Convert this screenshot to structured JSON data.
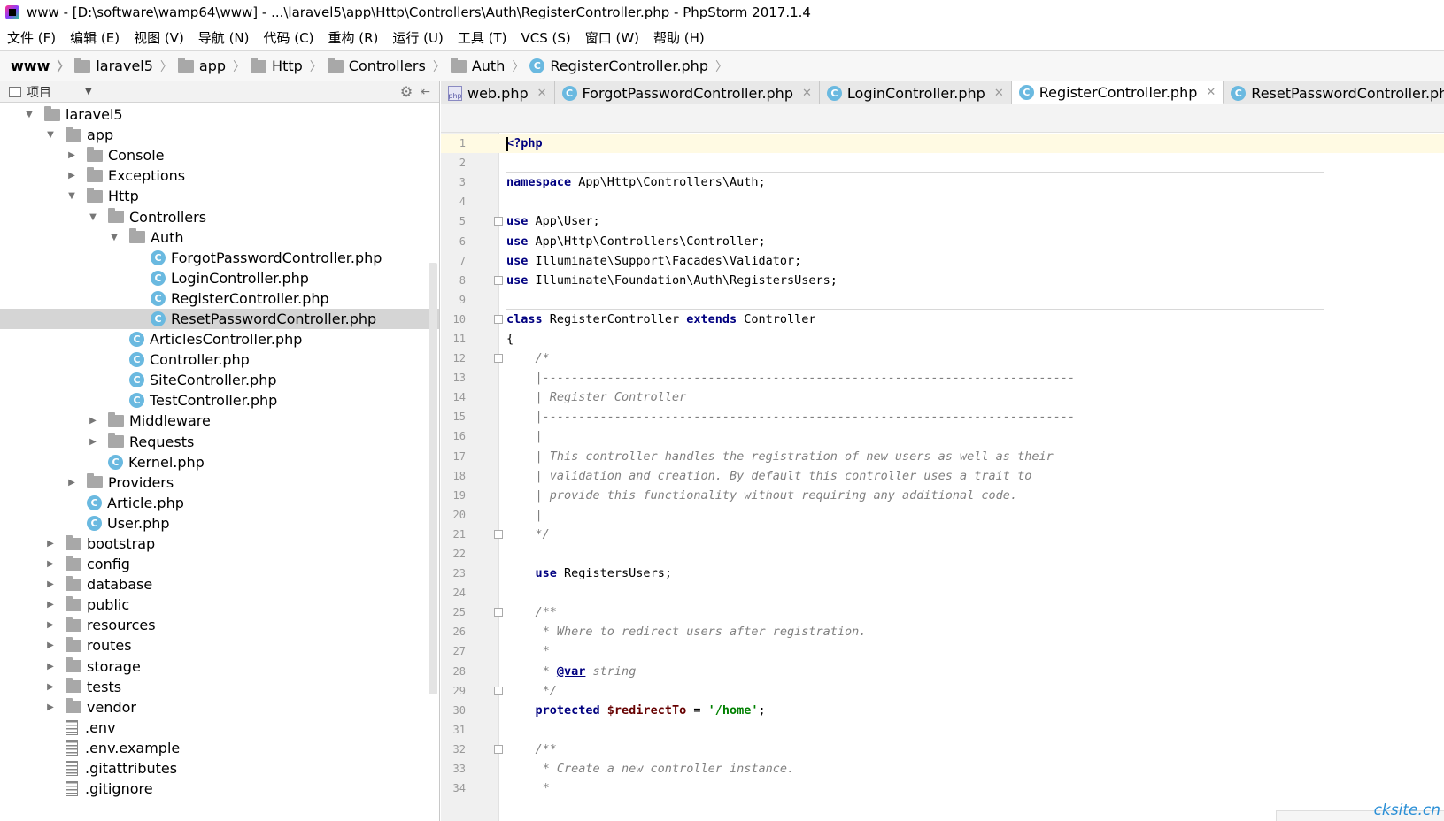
{
  "window": {
    "title": "www - [D:\\software\\wamp64\\www] - ...\\laravel5\\app\\Http\\Controllers\\Auth\\RegisterController.php - PhpStorm 2017.1.4"
  },
  "menu": [
    "文件 (F)",
    "编辑 (E)",
    "视图 (V)",
    "导航 (N)",
    "代码 (C)",
    "重构 (R)",
    "运行 (U)",
    "工具 (T)",
    "VCS (S)",
    "窗口 (W)",
    "帮助 (H)"
  ],
  "breadcrumb": [
    "www",
    "laravel5",
    "app",
    "Http",
    "Controllers",
    "Auth",
    "RegisterController.php"
  ],
  "project_panel": {
    "title": "项目",
    "tree": [
      {
        "label": "laravel5",
        "depth": 0,
        "type": "folder",
        "expanded": true
      },
      {
        "label": "app",
        "depth": 1,
        "type": "folder",
        "expanded": true
      },
      {
        "label": "Console",
        "depth": 2,
        "type": "folder",
        "expanded": false
      },
      {
        "label": "Exceptions",
        "depth": 2,
        "type": "folder",
        "expanded": false
      },
      {
        "label": "Http",
        "depth": 2,
        "type": "folder",
        "expanded": true
      },
      {
        "label": "Controllers",
        "depth": 3,
        "type": "folder",
        "expanded": true
      },
      {
        "label": "Auth",
        "depth": 4,
        "type": "folder",
        "expanded": true
      },
      {
        "label": "ForgotPasswordController.php",
        "depth": 5,
        "type": "class"
      },
      {
        "label": "LoginController.php",
        "depth": 5,
        "type": "class"
      },
      {
        "label": "RegisterController.php",
        "depth": 5,
        "type": "class"
      },
      {
        "label": "ResetPasswordController.php",
        "depth": 5,
        "type": "class",
        "selected": true
      },
      {
        "label": "ArticlesController.php",
        "depth": 4,
        "type": "class"
      },
      {
        "label": "Controller.php",
        "depth": 4,
        "type": "class"
      },
      {
        "label": "SiteController.php",
        "depth": 4,
        "type": "class"
      },
      {
        "label": "TestController.php",
        "depth": 4,
        "type": "class"
      },
      {
        "label": "Middleware",
        "depth": 3,
        "type": "folder",
        "expanded": false
      },
      {
        "label": "Requests",
        "depth": 3,
        "type": "folder",
        "expanded": false
      },
      {
        "label": "Kernel.php",
        "depth": 3,
        "type": "class"
      },
      {
        "label": "Providers",
        "depth": 2,
        "type": "folder",
        "expanded": false
      },
      {
        "label": "Article.php",
        "depth": 2,
        "type": "class"
      },
      {
        "label": "User.php",
        "depth": 2,
        "type": "class"
      },
      {
        "label": "bootstrap",
        "depth": 1,
        "type": "folder",
        "expanded": false
      },
      {
        "label": "config",
        "depth": 1,
        "type": "folder",
        "expanded": false
      },
      {
        "label": "database",
        "depth": 1,
        "type": "folder",
        "expanded": false
      },
      {
        "label": "public",
        "depth": 1,
        "type": "folder",
        "expanded": false
      },
      {
        "label": "resources",
        "depth": 1,
        "type": "folder",
        "expanded": false
      },
      {
        "label": "routes",
        "depth": 1,
        "type": "folder",
        "expanded": false
      },
      {
        "label": "storage",
        "depth": 1,
        "type": "folder",
        "expanded": false
      },
      {
        "label": "tests",
        "depth": 1,
        "type": "folder",
        "expanded": false
      },
      {
        "label": "vendor",
        "depth": 1,
        "type": "folder",
        "expanded": false
      },
      {
        "label": ".env",
        "depth": 1,
        "type": "file"
      },
      {
        "label": ".env.example",
        "depth": 1,
        "type": "file"
      },
      {
        "label": ".gitattributes",
        "depth": 1,
        "type": "file"
      },
      {
        "label": ".gitignore",
        "depth": 1,
        "type": "file"
      }
    ]
  },
  "tabs": [
    {
      "label": "web.php",
      "icon": "php",
      "active": false
    },
    {
      "label": "ForgotPasswordController.php",
      "icon": "class",
      "active": false
    },
    {
      "label": "LoginController.php",
      "icon": "class",
      "active": false
    },
    {
      "label": "RegisterController.php",
      "icon": "class",
      "active": true
    },
    {
      "label": "ResetPasswordController.php",
      "icon": "class",
      "active": false
    }
  ],
  "code": [
    {
      "n": "1",
      "current": true,
      "fold": false,
      "parts": [
        [
          "kw",
          "<?php"
        ]
      ]
    },
    {
      "n": "2",
      "fold": false,
      "parts": [],
      "hr": true
    },
    {
      "n": "3",
      "fold": false,
      "parts": [
        [
          "kw",
          "namespace "
        ],
        [
          "ns",
          "App\\Http\\Controllers\\Auth;"
        ]
      ]
    },
    {
      "n": "4",
      "fold": false,
      "parts": []
    },
    {
      "n": "5",
      "fold": true,
      "parts": [
        [
          "kw",
          "use "
        ],
        [
          "ns",
          "App\\User;"
        ]
      ]
    },
    {
      "n": "6",
      "fold": false,
      "parts": [
        [
          "kw",
          "use "
        ],
        [
          "ns",
          "App\\Http\\Controllers\\Controller;"
        ]
      ]
    },
    {
      "n": "7",
      "fold": false,
      "parts": [
        [
          "kw",
          "use "
        ],
        [
          "ns",
          "Illuminate\\Support\\Facades\\Validator;"
        ]
      ]
    },
    {
      "n": "8",
      "fold": true,
      "parts": [
        [
          "kw",
          "use "
        ],
        [
          "ns",
          "Illuminate\\Foundation\\Auth\\RegistersUsers;"
        ]
      ]
    },
    {
      "n": "9",
      "fold": false,
      "parts": [],
      "hr": true
    },
    {
      "n": "10",
      "fold": true,
      "parts": [
        [
          "kw",
          "class "
        ],
        [
          "ns",
          "RegisterController "
        ],
        [
          "kw",
          "extends "
        ],
        [
          "ns",
          "Controller"
        ]
      ]
    },
    {
      "n": "11",
      "fold": false,
      "parts": [
        [
          "ns",
          "{"
        ]
      ]
    },
    {
      "n": "12",
      "fold": true,
      "parts": [
        [
          "cm",
          "    /*"
        ]
      ]
    },
    {
      "n": "13",
      "fold": false,
      "parts": [
        [
          "cm",
          "    |--------------------------------------------------------------------------"
        ]
      ]
    },
    {
      "n": "14",
      "fold": false,
      "parts": [
        [
          "cm",
          "    | Register Controller"
        ]
      ]
    },
    {
      "n": "15",
      "fold": false,
      "parts": [
        [
          "cm",
          "    |--------------------------------------------------------------------------"
        ]
      ]
    },
    {
      "n": "16",
      "fold": false,
      "parts": [
        [
          "cm",
          "    |"
        ]
      ]
    },
    {
      "n": "17",
      "fold": false,
      "parts": [
        [
          "cm",
          "    | This controller handles the registration of new users as well as their"
        ]
      ]
    },
    {
      "n": "18",
      "fold": false,
      "parts": [
        [
          "cm",
          "    | validation and creation. By default this controller uses a trait to"
        ]
      ]
    },
    {
      "n": "19",
      "fold": false,
      "parts": [
        [
          "cm",
          "    | provide this functionality without requiring any additional code."
        ]
      ]
    },
    {
      "n": "20",
      "fold": false,
      "parts": [
        [
          "cm",
          "    |"
        ]
      ]
    },
    {
      "n": "21",
      "fold": true,
      "parts": [
        [
          "cm",
          "    */"
        ]
      ]
    },
    {
      "n": "22",
      "fold": false,
      "parts": []
    },
    {
      "n": "23",
      "fold": false,
      "parts": [
        [
          "kw",
          "    use "
        ],
        [
          "ns",
          "RegistersUsers;"
        ]
      ]
    },
    {
      "n": "24",
      "fold": false,
      "parts": []
    },
    {
      "n": "25",
      "fold": true,
      "parts": [
        [
          "cm",
          "    /**"
        ]
      ]
    },
    {
      "n": "26",
      "fold": false,
      "parts": [
        [
          "cm",
          "     * Where to redirect users after registration."
        ]
      ]
    },
    {
      "n": "27",
      "fold": false,
      "parts": [
        [
          "cm",
          "     *"
        ]
      ]
    },
    {
      "n": "28",
      "fold": false,
      "parts": [
        [
          "cm",
          "     * "
        ],
        [
          "tag",
          "@var"
        ],
        [
          "cm",
          " string"
        ]
      ]
    },
    {
      "n": "29",
      "fold": true,
      "parts": [
        [
          "cm",
          "     */"
        ]
      ]
    },
    {
      "n": "30",
      "fold": false,
      "parts": [
        [
          "kw",
          "    protected "
        ],
        [
          "var",
          "$redirectTo"
        ],
        [
          "ns",
          " = "
        ],
        [
          "str",
          "'/home'"
        ],
        [
          "ns",
          ";"
        ]
      ]
    },
    {
      "n": "31",
      "fold": false,
      "parts": []
    },
    {
      "n": "32",
      "fold": true,
      "parts": [
        [
          "cm",
          "    /**"
        ]
      ]
    },
    {
      "n": "33",
      "fold": false,
      "parts": [
        [
          "cm",
          "     * Create a new controller instance."
        ]
      ]
    },
    {
      "n": "34",
      "fold": false,
      "parts": [
        [
          "cm",
          "     *"
        ]
      ]
    }
  ],
  "watermark": "cksite.cn"
}
